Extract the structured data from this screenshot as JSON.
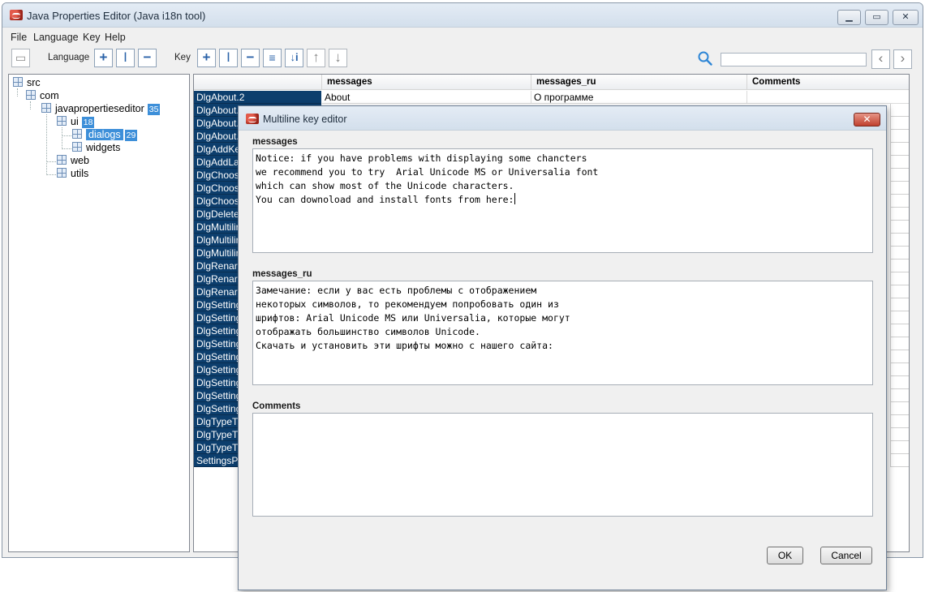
{
  "window": {
    "title": "Java Properties Editor (Java i18n tool)"
  },
  "menu": [
    "File",
    "Language",
    "Key",
    "Help"
  ],
  "toolbar": {
    "language_label": "Language",
    "key_label": "Key",
    "search_placeholder": ""
  },
  "tree": [
    {
      "label": "src"
    },
    {
      "label": "com"
    },
    {
      "label": "javapropertieseditor",
      "count": "35"
    },
    {
      "label": "ui",
      "count": "18"
    },
    {
      "label": "dialogs",
      "count": "29"
    },
    {
      "label": "widgets"
    },
    {
      "label": "web"
    },
    {
      "label": "utils"
    }
  ],
  "table": {
    "columns": [
      "messages",
      "messages_ru",
      "Comments"
    ],
    "keys": [
      "DlgAbout.2",
      "DlgAbout.",
      "DlgAbout.",
      "DlgAbout.",
      "DlgAddKe",
      "DlgAddLa",
      "DlgChoos",
      "DlgChoos",
      "DlgChoos",
      "DlgDelete",
      "DlgMultilir",
      "DlgMultilir",
      "DlgMultilir",
      "DlgRenar",
      "DlgRenar",
      "DlgRenar",
      "DlgSetting",
      "DlgSetting",
      "DlgSetting",
      "DlgSetting",
      "DlgSetting",
      "DlgSetting",
      "DlgSetting",
      "DlgSetting",
      "DlgSetting",
      "DlgTypeT",
      "DlgTypeT",
      "DlgTypeT",
      "SettingsP"
    ],
    "first_row": {
      "messages": "About",
      "messages_ru": "О программе"
    }
  },
  "dialog": {
    "title": "Multiline key editor",
    "messages_label": "messages",
    "messages_text": "Notice: if you have problems with displaying some chancters\nwe recommend you to try  Arial Unicode MS or Universalia font\nwhich can show most of the Unicode characters.\nYou can downoload and install fonts from here:",
    "messages_ru_label": "messages_ru",
    "messages_ru_text": "Замечание: если у вас есть проблемы с отображением\nнекоторых символов, то рекомендуем попробовать один из\nшрифтов: Arial Unicode MS или Universalia, которые могут\nотображать большинство символов Unicode.\nСкачать и установить эти шрифты можно с нашего сайта:",
    "comments_label": "Comments",
    "comments_text": "",
    "ok_label": "OK",
    "cancel_label": "Cancel"
  },
  "colors": {
    "selection": "#0c3e6d",
    "tree_highlight": "#3d8fd9",
    "close_button": "#c0402e"
  }
}
